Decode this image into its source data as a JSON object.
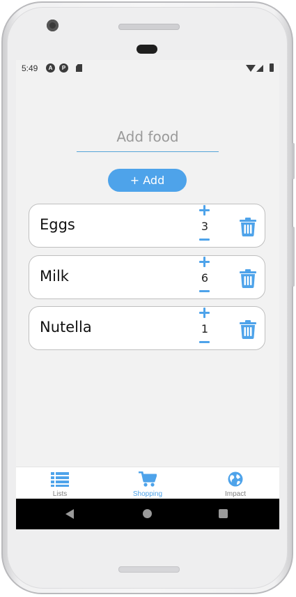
{
  "status_bar": {
    "time": "5:49",
    "notif_icon_1": "A",
    "notif_icon_2": "P"
  },
  "add_food": {
    "placeholder": "Add food",
    "value": ""
  },
  "add_button": {
    "label": "+ Add"
  },
  "items": [
    {
      "name": "Eggs",
      "quantity": "3"
    },
    {
      "name": "Milk",
      "quantity": "6"
    },
    {
      "name": "Nutella",
      "quantity": "1"
    }
  ],
  "bottom_nav": {
    "items": [
      {
        "label": "Lists",
        "icon": "list-icon",
        "active": false
      },
      {
        "label": "Shopping",
        "icon": "cart-icon",
        "active": true
      },
      {
        "label": "Impact",
        "icon": "globe-icon",
        "active": false
      }
    ]
  },
  "colors": {
    "accent": "#4ea3ea",
    "inactive": "#7f7f7f",
    "background": "#f2f2f2"
  }
}
